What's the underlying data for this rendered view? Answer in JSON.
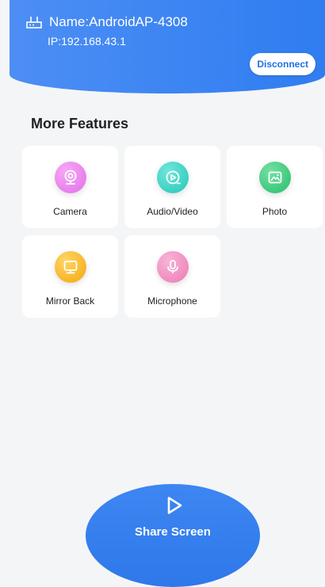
{
  "connection": {
    "name": "Name:AndroidAP-4308",
    "ip": "IP:192.168.43.1",
    "disconnect_label": "Disconnect"
  },
  "section": {
    "title": "More Features"
  },
  "features": [
    {
      "label": "Camera",
      "icon": "camera-icon",
      "color": "#e977ee"
    },
    {
      "label": "Audio/Video",
      "icon": "play-circle-icon",
      "color": "#39d2c4"
    },
    {
      "label": "Photo",
      "icon": "photo-icon",
      "color": "#3ccd7a"
    },
    {
      "label": "Mirror Back",
      "icon": "monitor-icon",
      "color": "#f5b421"
    },
    {
      "label": "Microphone",
      "icon": "microphone-icon",
      "color": "#f08cbf"
    }
  ],
  "share": {
    "label": "Share Screen",
    "icon": "play-icon"
  },
  "colors": {
    "accent": "#2f7df0",
    "background": "#f4f5f7"
  }
}
